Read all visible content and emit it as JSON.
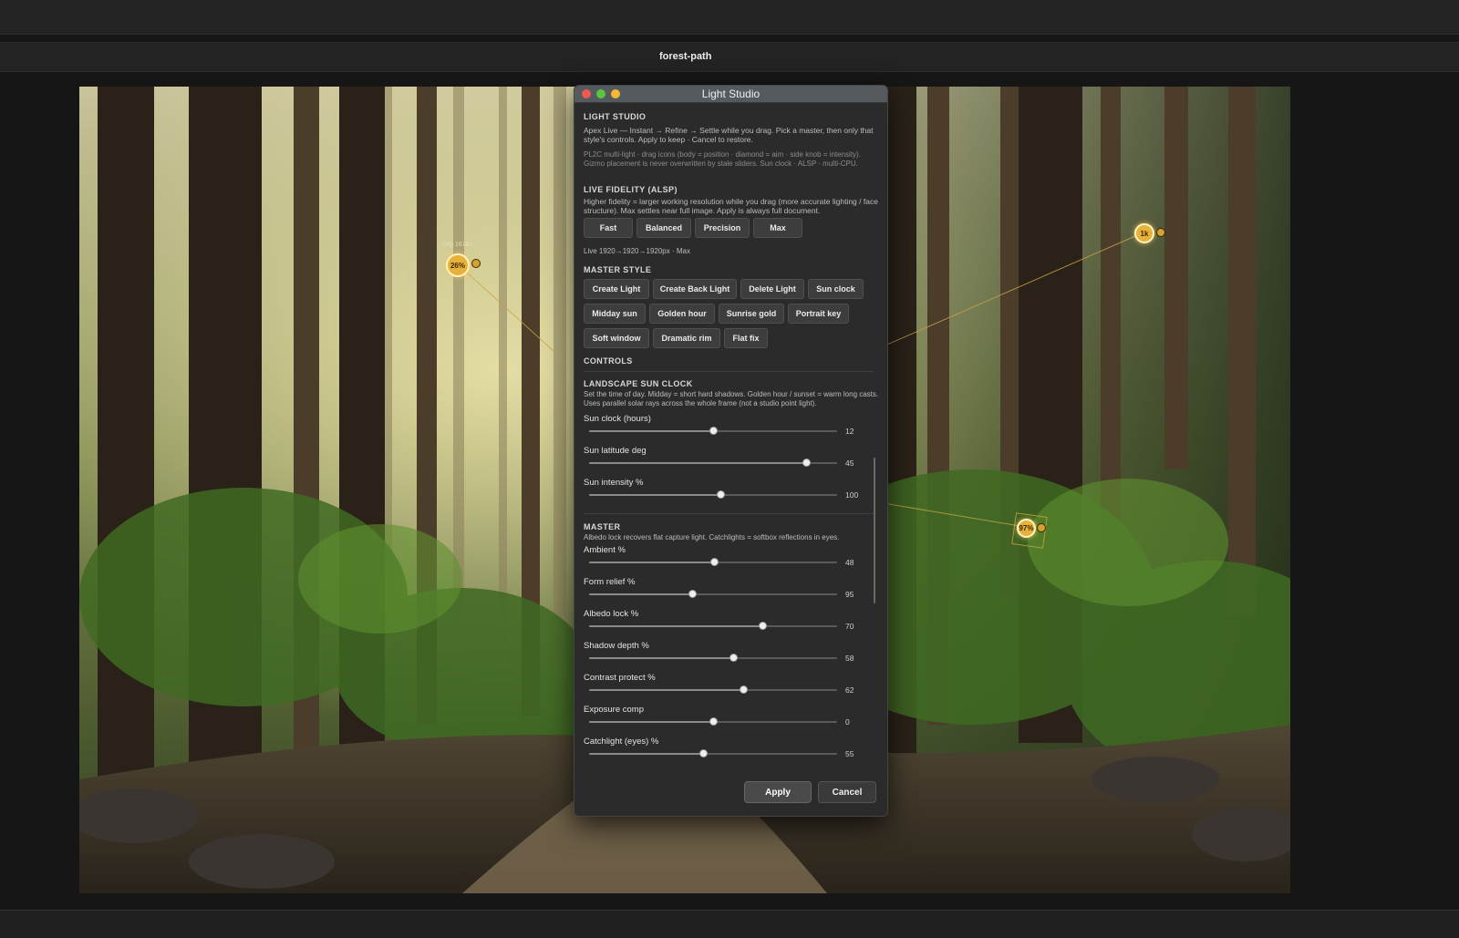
{
  "document": {
    "title": "forest-path"
  },
  "gizmos": [
    {
      "value": "26%",
      "label": "Key 1678+"
    },
    {
      "value": "1k"
    },
    {
      "value": "97%"
    }
  ],
  "dialog": {
    "title": "Light Studio",
    "intro": {
      "heading": "LIGHT STUDIO",
      "text": "Apex Live — Instant → Refine → Settle while you drag. Pick a master, then only that style's controls. Apply to keep · Cancel to restore.",
      "note": "PL2C multi-light · drag icons (body = position · diamond = aim · side knob = intensity). Gizmo placement is never overwritten by stale sliders. Sun clock · ALSP · multi-CPU."
    },
    "fidelity": {
      "heading": "LIVE FIDELITY (ALSP)",
      "text": "Higher fidelity = larger working resolution while you drag (more accurate lighting / face structure). Max settles near full image. Apply is always full document.",
      "buttons": [
        "Fast",
        "Balanced",
        "Precision",
        "Max"
      ],
      "status": "Live 1920→1920→1920px · Max"
    },
    "master_style": {
      "heading": "MASTER STYLE",
      "buttons": [
        "Create Light",
        "Create Back Light",
        "Delete Light",
        "Sun clock",
        "Midday sun",
        "Golden hour",
        "Sunrise gold",
        "Portrait key",
        "Soft window",
        "Dramatic rim",
        "Flat fix"
      ]
    },
    "controls": {
      "heading": "CONTROLS"
    },
    "sun_clock": {
      "heading": "LANDSCAPE SUN CLOCK",
      "text": "Set the time of day. Midday = short hard shadows. Golden hour / sunset = warm long casts. Uses parallel solar rays across the whole frame (not a studio point light).",
      "sliders": [
        {
          "label": "Sun clock (hours)",
          "value": "12",
          "level": 0.5
        },
        {
          "label": "Sun latitude deg",
          "value": "45",
          "level": 0.875
        },
        {
          "label": "Sun intensity %",
          "value": "100",
          "level": 0.53
        }
      ]
    },
    "master": {
      "heading": "MASTER",
      "text": "Albedo lock recovers flat capture light. Catchlights = softbox reflections in eyes.",
      "sliders": [
        {
          "label": "Ambient %",
          "value": "48",
          "level": 0.505
        },
        {
          "label": "Form relief %",
          "value": "95",
          "level": 0.415
        },
        {
          "label": "Albedo lock %",
          "value": "70",
          "level": 0.7
        },
        {
          "label": "Shadow depth %",
          "value": "58",
          "level": 0.58
        },
        {
          "label": "Contrast protect %",
          "value": "62",
          "level": 0.62
        },
        {
          "label": "Exposure comp",
          "value": "0",
          "level": 0.5
        },
        {
          "label": "Catchlight (eyes) %",
          "value": "55",
          "level": 0.46
        }
      ]
    },
    "apply_label": "Apply",
    "cancel_label": "Cancel"
  }
}
